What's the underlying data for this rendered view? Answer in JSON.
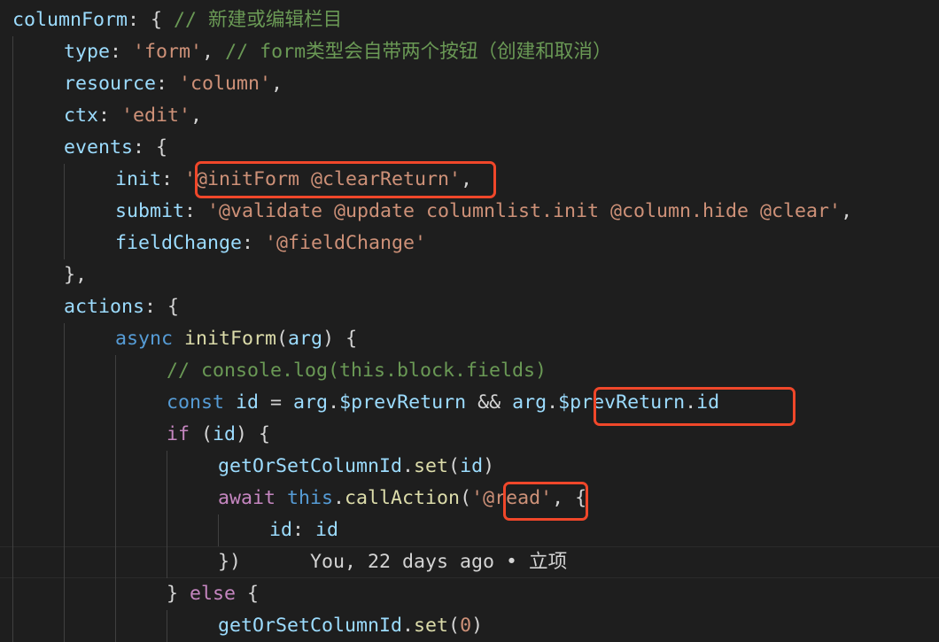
{
  "editor": {
    "theme_background": "#1e1e1e",
    "highlight_color": "#f0472a",
    "lines": [
      {
        "indent": 0,
        "tokens": [
          {
            "t": "columnForm",
            "c": "key"
          },
          {
            "t": ": { ",
            "c": "pun"
          },
          {
            "t": "// 新建或编辑栏目",
            "c": "cmt"
          }
        ]
      },
      {
        "indent": 1,
        "tokens": [
          {
            "t": "type",
            "c": "key"
          },
          {
            "t": ": ",
            "c": "pun"
          },
          {
            "t": "'form'",
            "c": "str"
          },
          {
            "t": ", ",
            "c": "pun"
          },
          {
            "t": "// form类型会自带两个按钮（创建和取消）",
            "c": "cmt"
          }
        ]
      },
      {
        "indent": 1,
        "tokens": [
          {
            "t": "resource",
            "c": "key"
          },
          {
            "t": ": ",
            "c": "pun"
          },
          {
            "t": "'column'",
            "c": "str"
          },
          {
            "t": ",",
            "c": "pun"
          }
        ]
      },
      {
        "indent": 1,
        "tokens": [
          {
            "t": "ctx",
            "c": "key"
          },
          {
            "t": ": ",
            "c": "pun"
          },
          {
            "t": "'edit'",
            "c": "str"
          },
          {
            "t": ",",
            "c": "pun"
          }
        ]
      },
      {
        "indent": 1,
        "tokens": [
          {
            "t": "events",
            "c": "key"
          },
          {
            "t": ": {",
            "c": "pun"
          }
        ]
      },
      {
        "indent": 2,
        "tokens": [
          {
            "t": "init",
            "c": "key"
          },
          {
            "t": ": ",
            "c": "pun"
          },
          {
            "t": "'@initForm @clearReturn'",
            "c": "str"
          },
          {
            "t": ",",
            "c": "pun"
          }
        ]
      },
      {
        "indent": 2,
        "tokens": [
          {
            "t": "submit",
            "c": "key"
          },
          {
            "t": ": ",
            "c": "pun"
          },
          {
            "t": "'@validate @update columnlist.init @column.hide @clear'",
            "c": "str"
          },
          {
            "t": ",",
            "c": "pun"
          }
        ]
      },
      {
        "indent": 2,
        "tokens": [
          {
            "t": "fieldChange",
            "c": "key"
          },
          {
            "t": ": ",
            "c": "pun"
          },
          {
            "t": "'@fieldChange'",
            "c": "str"
          }
        ]
      },
      {
        "indent": 1,
        "tokens": [
          {
            "t": "},",
            "c": "pun"
          }
        ]
      },
      {
        "indent": 1,
        "tokens": [
          {
            "t": "actions",
            "c": "key"
          },
          {
            "t": ": {",
            "c": "pun"
          }
        ]
      },
      {
        "indent": 2,
        "tokens": [
          {
            "t": "async ",
            "c": "kw"
          },
          {
            "t": "initForm",
            "c": "fn"
          },
          {
            "t": "(",
            "c": "pun"
          },
          {
            "t": "arg",
            "c": "var"
          },
          {
            "t": ") {",
            "c": "pun"
          }
        ]
      },
      {
        "indent": 3,
        "tokens": [
          {
            "t": "// console.log(this.block.fields)",
            "c": "cmt"
          }
        ]
      },
      {
        "indent": 3,
        "tokens": [
          {
            "t": "const ",
            "c": "kw"
          },
          {
            "t": "id",
            "c": "var"
          },
          {
            "t": " = ",
            "c": "pun"
          },
          {
            "t": "arg",
            "c": "var"
          },
          {
            "t": ".",
            "c": "pun"
          },
          {
            "t": "$prevReturn",
            "c": "var"
          },
          {
            "t": " && ",
            "c": "pun"
          },
          {
            "t": "arg",
            "c": "var"
          },
          {
            "t": ".",
            "c": "pun"
          },
          {
            "t": "$prevReturn",
            "c": "var"
          },
          {
            "t": ".",
            "c": "pun"
          },
          {
            "t": "id",
            "c": "var"
          }
        ]
      },
      {
        "indent": 3,
        "tokens": [
          {
            "t": "if",
            "c": "ctl"
          },
          {
            "t": " (",
            "c": "pun"
          },
          {
            "t": "id",
            "c": "var"
          },
          {
            "t": ") {",
            "c": "pun"
          }
        ]
      },
      {
        "indent": 4,
        "tokens": [
          {
            "t": "getOrSetColumnId",
            "c": "var"
          },
          {
            "t": ".",
            "c": "pun"
          },
          {
            "t": "set",
            "c": "fn"
          },
          {
            "t": "(",
            "c": "pun"
          },
          {
            "t": "id",
            "c": "var"
          },
          {
            "t": ")",
            "c": "pun"
          }
        ]
      },
      {
        "indent": 4,
        "tokens": [
          {
            "t": "await ",
            "c": "ctl"
          },
          {
            "t": "this",
            "c": "kw"
          },
          {
            "t": ".",
            "c": "pun"
          },
          {
            "t": "callAction",
            "c": "fn"
          },
          {
            "t": "(",
            "c": "pun"
          },
          {
            "t": "'@read'",
            "c": "str"
          },
          {
            "t": ", {",
            "c": "pun"
          }
        ]
      },
      {
        "indent": 5,
        "tokens": [
          {
            "t": "id",
            "c": "key"
          },
          {
            "t": ": ",
            "c": "pun"
          },
          {
            "t": "id",
            "c": "var"
          }
        ]
      },
      {
        "indent": 4,
        "tokens": [
          {
            "t": "})",
            "c": "pun"
          },
          {
            "t": "      You, 22 days ago • 立项",
            "c": "blame"
          }
        ]
      },
      {
        "indent": 3,
        "tokens": [
          {
            "t": "} ",
            "c": "pun"
          },
          {
            "t": "else",
            "c": "ctl"
          },
          {
            "t": " {",
            "c": "pun"
          }
        ]
      },
      {
        "indent": 4,
        "tokens": [
          {
            "t": "getOrSetColumnId",
            "c": "var"
          },
          {
            "t": ".",
            "c": "pun"
          },
          {
            "t": "set",
            "c": "fn"
          },
          {
            "t": "(",
            "c": "pun"
          },
          {
            "t": "0",
            "c": "str"
          },
          {
            "t": ")",
            "c": "pun"
          }
        ]
      }
    ]
  }
}
